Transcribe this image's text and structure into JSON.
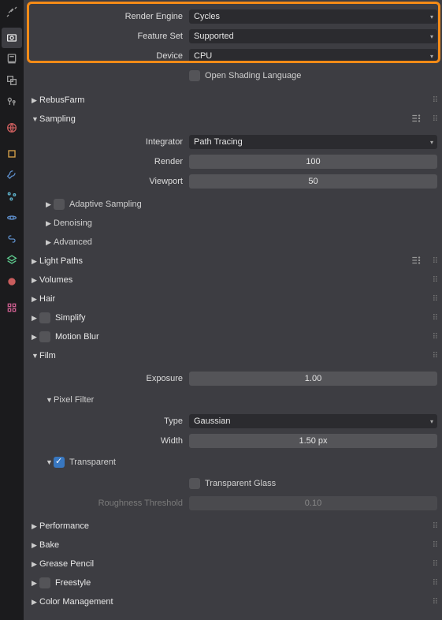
{
  "header": {
    "renderEngineLabel": "Render Engine",
    "renderEngineVal": "Cycles",
    "featureSetLabel": "Feature Set",
    "featureSetVal": "Supported",
    "deviceLabel": "Device",
    "deviceVal": "CPU",
    "oslLabel": "Open Shading Language"
  },
  "sections": {
    "rebusfarm": "RebusFarm",
    "sampling": "Sampling",
    "integratorLabel": "Integrator",
    "integratorVal": "Path Tracing",
    "renderLabel": "Render",
    "renderVal": "100",
    "viewportLabel": "Viewport",
    "viewportVal": "50",
    "adaptive": "Adaptive Sampling",
    "denoising": "Denoising",
    "advanced": "Advanced",
    "lightpaths": "Light Paths",
    "volumes": "Volumes",
    "hair": "Hair",
    "simplify": "Simplify",
    "motionblur": "Motion Blur",
    "film": "Film",
    "exposureLabel": "Exposure",
    "exposureVal": "1.00",
    "pixelfilter": "Pixel Filter",
    "typeLabel": "Type",
    "typeVal": "Gaussian",
    "widthLabel": "Width",
    "widthVal": "1.50 px",
    "transparent": "Transparent",
    "transglass": "Transparent Glass",
    "roughnessLabel": "Roughness Threshold",
    "roughnessVal": "0.10",
    "performance": "Performance",
    "bake": "Bake",
    "greasepencil": "Grease Pencil",
    "freestyle": "Freestyle",
    "colormgmt": "Color Management"
  }
}
